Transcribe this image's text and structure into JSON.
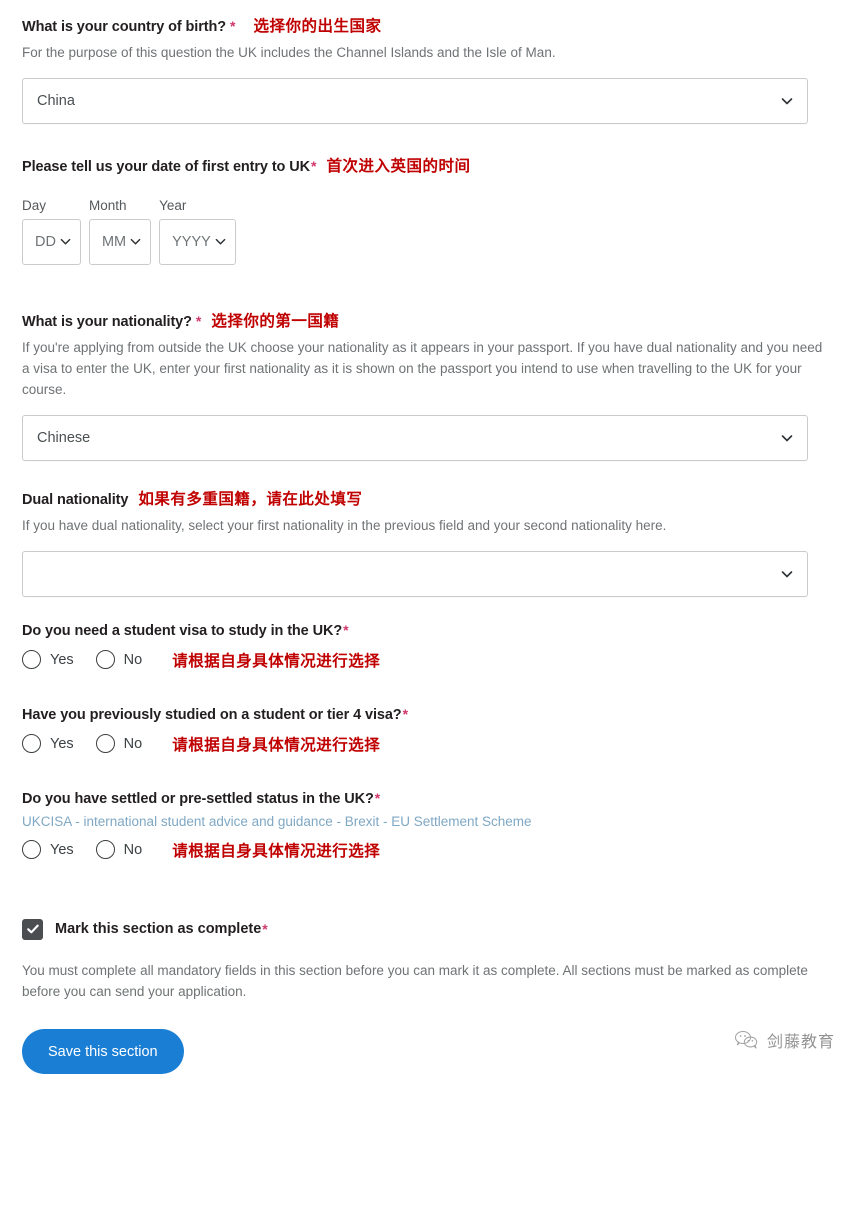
{
  "colors": {
    "annotation_red": "#c00000",
    "required_star": "#d1376a",
    "link_blue": "#7fa8c4",
    "button_blue": "#1a7fd4",
    "checkbox_dark": "#4a4e50",
    "border_grey": "#c9ccce",
    "helper_grey": "#6f7375"
  },
  "country_of_birth": {
    "label": "What is your country of birth?",
    "required_mark": "*",
    "annotation": "选择你的出生国家",
    "helper": "For the purpose of this question the UK includes the Channel Islands and the Isle of Man.",
    "select_value": "China",
    "chevron_icon": "chevron-down-icon"
  },
  "first_entry_date": {
    "label": "Please tell us your date of first entry to UK",
    "required_mark": "*",
    "annotation": "首次进入英国的时间",
    "day": {
      "legend": "Day",
      "value": "DD"
    },
    "month": {
      "legend": "Month",
      "value": "MM"
    },
    "year": {
      "legend": "Year",
      "value": "YYYY"
    }
  },
  "nationality": {
    "label": "What is your nationality?",
    "required_mark": "*",
    "annotation": "选择你的第一国籍",
    "helper": "If you're applying from outside the UK choose your nationality as it appears in your passport. If you have dual nationality and you need a visa to enter the UK, enter your first nationality as it is shown on the passport you intend to use when travelling to the UK for your course.",
    "select_value": "Chinese"
  },
  "dual_nationality": {
    "label": "Dual nationality",
    "annotation": "如果有多重国籍，请在此处填写",
    "helper": "If you have dual nationality, select your first nationality in the previous field and your second nationality here.",
    "select_value": ""
  },
  "student_visa": {
    "label": "Do you need a student visa to study in the UK?",
    "required_mark": "*",
    "annotation": "请根据自身具体情况进行选择",
    "options": [
      {
        "label": "Yes",
        "selected": false
      },
      {
        "label": "No",
        "selected": false
      }
    ]
  },
  "previous_study_visa": {
    "label": "Have you previously studied on a student or tier 4 visa?",
    "required_mark": "*",
    "annotation": "请根据自身具体情况进行选择",
    "options": [
      {
        "label": "Yes",
        "selected": false
      },
      {
        "label": "No",
        "selected": false
      }
    ]
  },
  "settled_status": {
    "label": "Do you have settled or pre-settled status in the UK?",
    "required_mark": "*",
    "link_text": "UKCISA - international student advice and guidance - Brexit - EU Settlement Scheme",
    "annotation": "请根据自身具体情况进行选择",
    "options": [
      {
        "label": "Yes",
        "selected": false
      },
      {
        "label": "No",
        "selected": false
      }
    ]
  },
  "section_complete": {
    "checkbox_label": "Mark this section as complete",
    "required_mark": "*",
    "checked": true,
    "note": "You must complete all mandatory fields in this section before you can mark it as complete. All sections must be marked as complete before you can send your application."
  },
  "save": {
    "button_label": "Save this section"
  },
  "watermark": {
    "text": "剑藤教育",
    "logo_icon": "wechat-logo-icon"
  }
}
